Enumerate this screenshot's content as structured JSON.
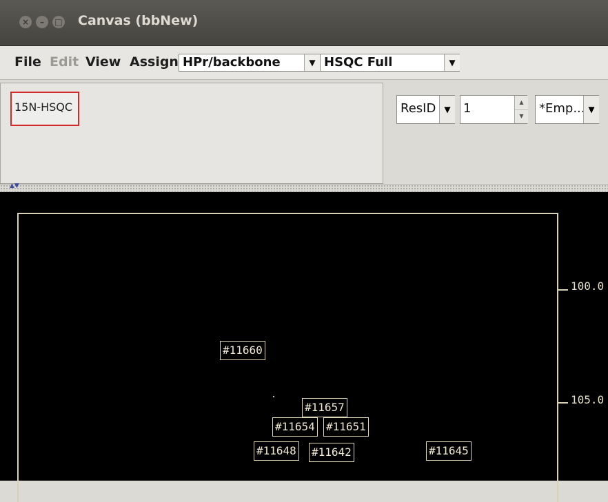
{
  "window": {
    "title": "Canvas (bbNew)"
  },
  "menu": {
    "file": "File",
    "edit": "Edit",
    "view": "View",
    "assign": "Assign"
  },
  "selectors": {
    "molecule": "HPr/backbone",
    "peaklist": "HSQC Full"
  },
  "spectrum": {
    "label": "15N-HSQC"
  },
  "controls": {
    "residue_field": "ResID",
    "residue_value": "1",
    "empty_option": "*Emp..."
  },
  "axis": {
    "ticks": [
      "100.0",
      "105.0"
    ]
  },
  "peaks": [
    "#11660",
    "#11657",
    "#11654",
    "#11651",
    "#11648",
    "#11642",
    "#11645"
  ],
  "colors": {
    "canvas_bg": "#000000",
    "peak_label": "#e1d9b5",
    "selected_border": "#d42a2a"
  }
}
